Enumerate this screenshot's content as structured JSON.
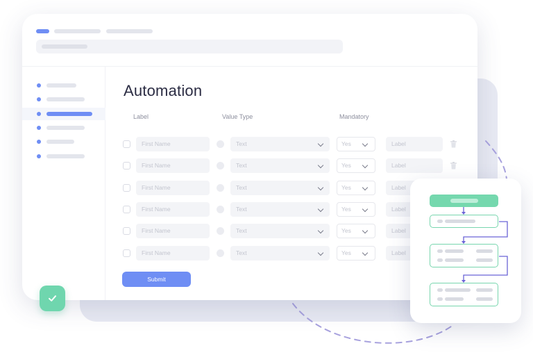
{
  "page": {
    "title": "Automation"
  },
  "form": {
    "columns": {
      "label": "Label",
      "value_type": "Value Type",
      "mandatory": "Mandatory"
    },
    "rows": [
      {
        "label_placeholder": "First Name",
        "value_type": "Text",
        "mandatory": "Yes",
        "label_value": "Label"
      },
      {
        "label_placeholder": "First Name",
        "value_type": "Text",
        "mandatory": "Yes",
        "label_value": "Label"
      },
      {
        "label_placeholder": "First Name",
        "value_type": "Text",
        "mandatory": "Yes",
        "label_value": "Label"
      },
      {
        "label_placeholder": "First Name",
        "value_type": "Text",
        "mandatory": "Yes",
        "label_value": "Label"
      },
      {
        "label_placeholder": "First Name",
        "value_type": "Text",
        "mandatory": "Yes",
        "label_value": "Label"
      },
      {
        "label_placeholder": "First Name",
        "value_type": "Text",
        "mandatory": "Yes",
        "label_value": "Label"
      }
    ],
    "submit_label": "Submit"
  },
  "sidebar": {
    "active_index": 2
  },
  "colors": {
    "accent": "#6f8ef4",
    "success": "#6fd6ae",
    "flow_border": "#78d6ae",
    "connector": "#6a64d6",
    "dashed_path": "#a8a2de"
  },
  "icons": {
    "badge": "check-icon",
    "row_action": "trash-icon",
    "select": "chevron-down-icon"
  }
}
